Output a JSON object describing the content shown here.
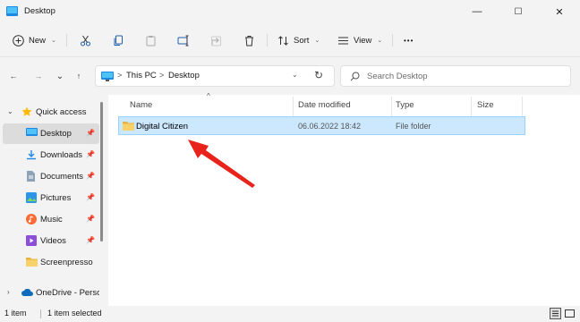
{
  "window": {
    "title": "Desktop",
    "minimize_glyph": "—",
    "maximize_glyph": "☐",
    "close_glyph": "✕"
  },
  "toolbar": {
    "new_label": "New",
    "sort_label": "Sort",
    "view_label": "View",
    "more_glyph": "•••"
  },
  "nav": {
    "back_glyph": "←",
    "forward_glyph": "→",
    "recent_glyph": "⌄",
    "up_glyph": "↑"
  },
  "address": {
    "crumbs": [
      "This PC",
      "Desktop"
    ],
    "separator": ">"
  },
  "search": {
    "placeholder": "Search Desktop"
  },
  "sidebar": {
    "quick_access": "Quick access",
    "items": [
      {
        "label": "Desktop",
        "pinned": true,
        "icon": "desktop-icon"
      },
      {
        "label": "Downloads",
        "pinned": true,
        "icon": "downloads-icon"
      },
      {
        "label": "Documents",
        "pinned": true,
        "icon": "documents-icon"
      },
      {
        "label": "Pictures",
        "pinned": true,
        "icon": "pictures-icon"
      },
      {
        "label": "Music",
        "pinned": true,
        "icon": "music-icon"
      },
      {
        "label": "Videos",
        "pinned": true,
        "icon": "videos-icon"
      },
      {
        "label": "Screenpresso",
        "pinned": false,
        "icon": "folder-icon"
      }
    ],
    "onedrive": "OneDrive - Perso"
  },
  "columns": {
    "name": "Name",
    "date": "Date modified",
    "type": "Type",
    "size": "Size"
  },
  "files": [
    {
      "name": "Digital Citizen",
      "date": "06.06.2022 18:42",
      "type": "File folder",
      "size": ""
    }
  ],
  "status": {
    "count": "1 item",
    "selected": "1 item selected"
  },
  "colors": {
    "selection_bg": "#cce8ff",
    "selection_border": "#99d1ff",
    "arrow": "#e8231c",
    "accent": "#0067c0"
  }
}
